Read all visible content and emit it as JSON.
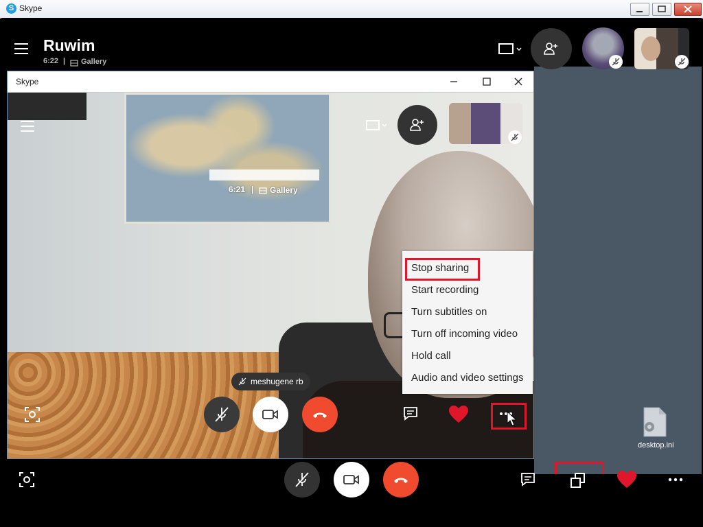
{
  "os_window": {
    "title": "Skype"
  },
  "call": {
    "name": "Ruwim",
    "time": "6:22",
    "separator": "|",
    "view_label": "Gallery"
  },
  "inner_window": {
    "title": "Skype",
    "time": "6:21",
    "separator": "|",
    "view_label": "Gallery",
    "participant_label": "meshugene rb"
  },
  "more_menu": {
    "items": [
      "Stop sharing",
      "Start recording",
      "Turn subtitles on",
      "Turn off incoming video",
      "Hold call",
      "Audio and video settings"
    ]
  },
  "desktop": {
    "file_label": "desktop.ini"
  },
  "colors": {
    "end_call": "#f04a2f",
    "heart": "#e0162b",
    "highlight": "#e0162b",
    "accent": "#1ea0e8"
  }
}
